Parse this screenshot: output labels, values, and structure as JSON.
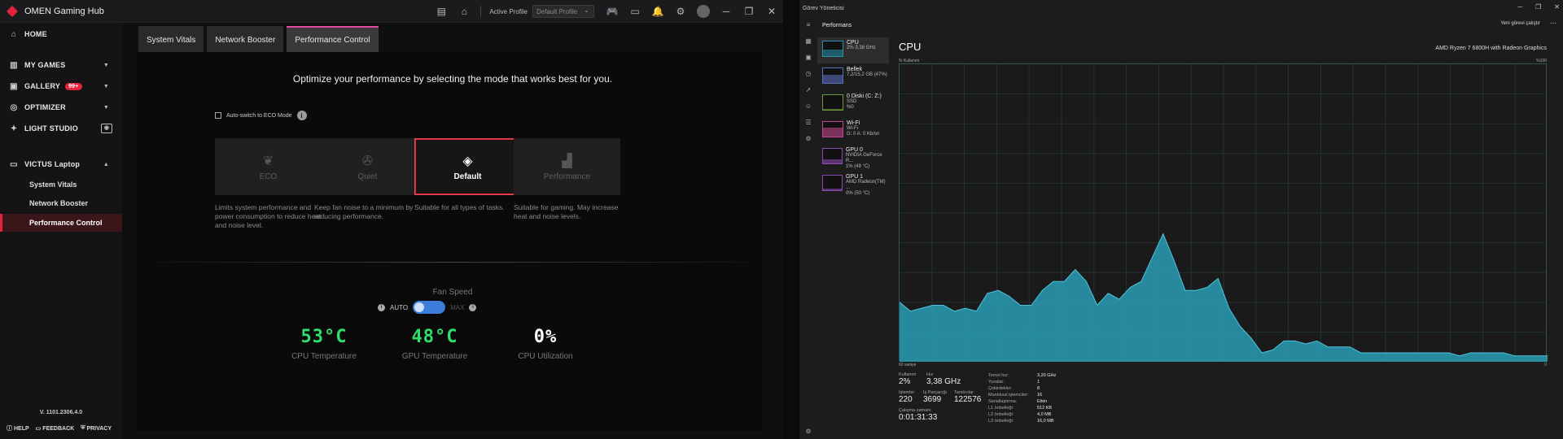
{
  "omen": {
    "app_title": "OMEN Gaming Hub",
    "active_profile_label": "Active Profile",
    "active_profile_value": "Default Profile",
    "nav": {
      "home": "HOME",
      "my_games": "MY GAMES",
      "gallery": "GALLERY",
      "gallery_badge": "99+",
      "optimizer": "OPTIMIZER",
      "light_studio": "LIGHT STUDIO",
      "device": "VICTUS Laptop",
      "sub_items": [
        "System Vitals",
        "Network Booster",
        "Performance Control"
      ]
    },
    "version": "V. 1101.2306.4.0",
    "footer": {
      "help": "HELP",
      "feedback": "FEEDBACK",
      "privacy": "PRIVACY"
    },
    "tabs": [
      "System Vitals",
      "Network Booster",
      "Performance Control"
    ],
    "active_tab": "Performance Control",
    "headline": "Optimize your performance by selecting the mode that works best for you.",
    "auto_switch_label": "Auto-switch to ECO Mode",
    "modes": [
      {
        "label": "ECO",
        "icon": "leaf-icon",
        "desc": "Limits system performance and power consumption to reduce heat and noise level."
      },
      {
        "label": "Quiet",
        "icon": "fan-icon",
        "desc": "Keep fan noise to a minimum by reducing performance."
      },
      {
        "label": "Default",
        "icon": "diamond-icon",
        "desc": "Suitable for all types of tasks."
      },
      {
        "label": "Performance",
        "icon": "bars-icon",
        "desc": "Suitable for gaming. May increase heat and noise levels."
      }
    ],
    "selected_mode": "Default",
    "fan_speed_title": "Fan Speed",
    "fan_auto": "AUTO",
    "fan_max": "MAX",
    "metrics": [
      {
        "value": "53°C",
        "label": "CPU Temperature",
        "color": "#2fe06a"
      },
      {
        "value": "48°C",
        "label": "GPU Temperature",
        "color": "#2fe06a"
      },
      {
        "value": "0%",
        "label": "CPU Utilization",
        "color": "#ffffff"
      }
    ]
  },
  "taskmgr": {
    "window_title": "Görev Yöneticisi",
    "section_title": "Performans",
    "new_task": "Yeni görevi çalıştır",
    "processes": [
      {
        "name": "CPU",
        "l1": "2% 3,38 GHz",
        "l2": ""
      },
      {
        "name": "Bellek",
        "l1": "7,2/15,2 GB (47%)",
        "l2": ""
      },
      {
        "name": "0 Diski (C: Z:)",
        "l1": "SSD",
        "l2": "%0"
      },
      {
        "name": "Wi-Fi",
        "l1": "Wi-Fi",
        "l2": "G: 0 A: 0 Kb/sn"
      },
      {
        "name": "GPU 0",
        "l1": "NVIDIA GeForce R...",
        "l2": "1% (48 °C)"
      },
      {
        "name": "GPU 1",
        "l1": "AMD Radeon(TM) ...",
        "l2": "0% (50 °C)"
      }
    ],
    "cpu_title": "CPU",
    "cpu_model": "AMD Ryzen 7 6800H with Radeon Graphics",
    "util_label": "% Kullanım",
    "util_max": "%100",
    "graph_time": "60 saniye",
    "graph_min": "0",
    "chart_data": {
      "type": "area",
      "title": "",
      "xlabel": "60 saniye",
      "ylabel": "% Kullanım",
      "ylim": [
        0,
        100
      ],
      "values": [
        20,
        17,
        18,
        19,
        19,
        17,
        18,
        17,
        23,
        24,
        22,
        19,
        19,
        24,
        27,
        27,
        31,
        27,
        19,
        23,
        21,
        25,
        27,
        35,
        43,
        34,
        24,
        24,
        25,
        28,
        18,
        12,
        8,
        3,
        4,
        7,
        7,
        6,
        7,
        5,
        5,
        5,
        3,
        3,
        3,
        3,
        3,
        3,
        3,
        3,
        3,
        2,
        3,
        3,
        3,
        3,
        2,
        2,
        2,
        2
      ]
    },
    "stats": {
      "kullanim_k": "Kullanım",
      "kullanim_v": "2%",
      "hiz_k": "Hız",
      "hiz_v": "3,38 GHz",
      "islemler_k": "İşlemler",
      "islemler_v": "220",
      "is_parcacigi_k": "İş Parçacığı",
      "is_parcacigi_v": "3699",
      "tanitıcılar_k": "Tanıtıcılar",
      "tanitıcılar_v": "122576",
      "calisma_k": "Çalışma zamanı",
      "calisma_v": "0:01:31:33"
    },
    "specs": [
      [
        "Temel hız:",
        "3,20 GHz"
      ],
      [
        "Yuvalar:",
        "1"
      ],
      [
        "Çekirdekler:",
        "8"
      ],
      [
        "Mantıksal işlemciler:",
        "16"
      ],
      [
        "Sanallaştırma:",
        "Etkin"
      ],
      [
        "L1 önbelleği:",
        "512 KB"
      ],
      [
        "L2 önbelleği:",
        "4,0 MB"
      ],
      [
        "L3 önbelleği:",
        "16,0 MB"
      ]
    ]
  }
}
